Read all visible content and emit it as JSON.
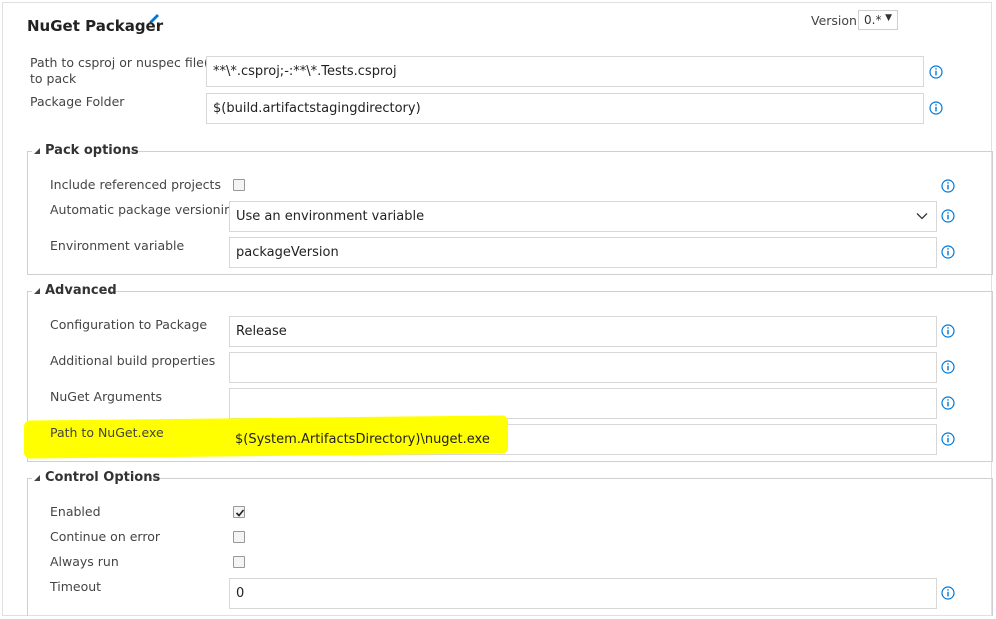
{
  "header": {
    "title": "NuGet Packager",
    "version_label": "Version",
    "version_value": "0.*"
  },
  "main": {
    "path_label_line1": "Path to csproj or nuspec file(s)",
    "path_label_line2": "to pack",
    "path_value": "**\\*.csproj;-:**\\*.Tests.csproj",
    "folder_label": "Package Folder",
    "folder_value": "$(build.artifactstagingdirectory)"
  },
  "pack_options": {
    "title": "Pack options",
    "include_label": "Include referenced projects",
    "include_checked": false,
    "versioning_label": "Automatic package versioning",
    "versioning_value": "Use an environment variable",
    "envvar_label": "Environment variable",
    "envvar_value": "packageVersion"
  },
  "advanced": {
    "title": "Advanced",
    "config_label": "Configuration to Package",
    "config_value": "Release",
    "buildprops_label": "Additional build properties",
    "buildprops_value": "",
    "args_label": "NuGet Arguments",
    "args_value": "",
    "nugetpath_label": "Path to NuGet.exe",
    "nugetpath_value": "$(System.ArtifactsDirectory)\\nuget.exe",
    "highlight_color": "#ffff00"
  },
  "control_options": {
    "title": "Control Options",
    "enabled_label": "Enabled",
    "enabled_checked": true,
    "continue_label": "Continue on error",
    "continue_checked": false,
    "always_label": "Always run",
    "always_checked": false,
    "timeout_label": "Timeout",
    "timeout_value": "0"
  },
  "colors": {
    "accent": "#0078d7",
    "border": "#d7d7d7"
  },
  "icons": [
    "pencil-icon",
    "info-icon",
    "chevron-down-icon",
    "collapse-triangle-icon",
    "checkmark-icon"
  ]
}
